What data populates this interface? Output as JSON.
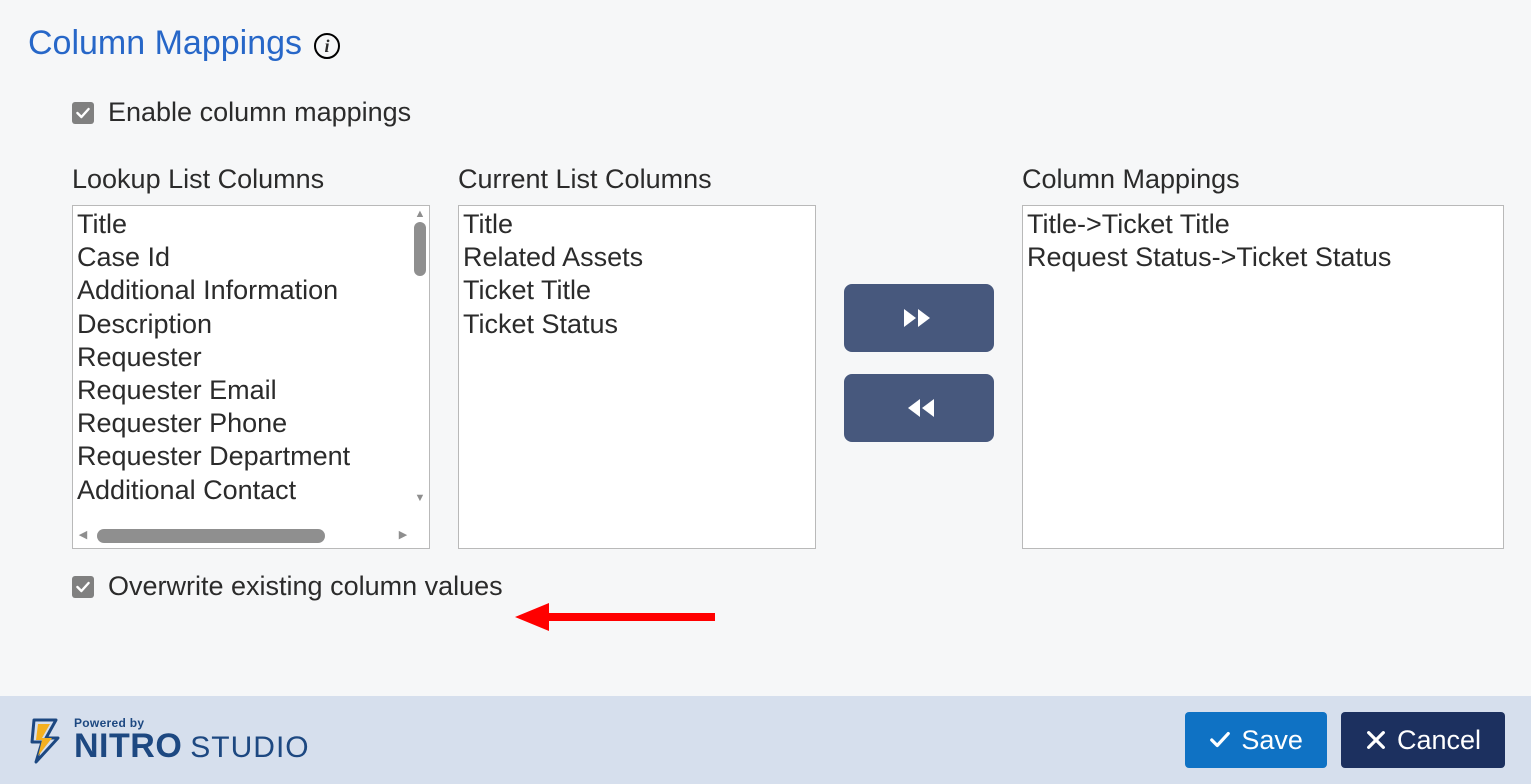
{
  "section": {
    "title": "Column Mappings"
  },
  "checkboxes": {
    "enable_label": "Enable column mappings",
    "overwrite_label": "Overwrite existing column values"
  },
  "lists": {
    "lookup_label": "Lookup List Columns",
    "current_label": "Current List Columns",
    "mappings_label": "Column Mappings",
    "lookup_items": [
      "Title",
      "Case Id",
      "Additional Information",
      "Description",
      "Requester",
      "Requester Email",
      "Requester Phone",
      "Requester Department",
      "Additional Contact"
    ],
    "current_items": [
      "Title",
      "Related Assets",
      "Ticket Title",
      "Ticket Status"
    ],
    "mapping_items": [
      "Title->Ticket Title",
      "Request Status->Ticket Status"
    ]
  },
  "branding": {
    "powered": "Powered by",
    "nitro": "NITRO",
    "studio": "STUDIO"
  },
  "buttons": {
    "save": "Save",
    "cancel": "Cancel"
  }
}
